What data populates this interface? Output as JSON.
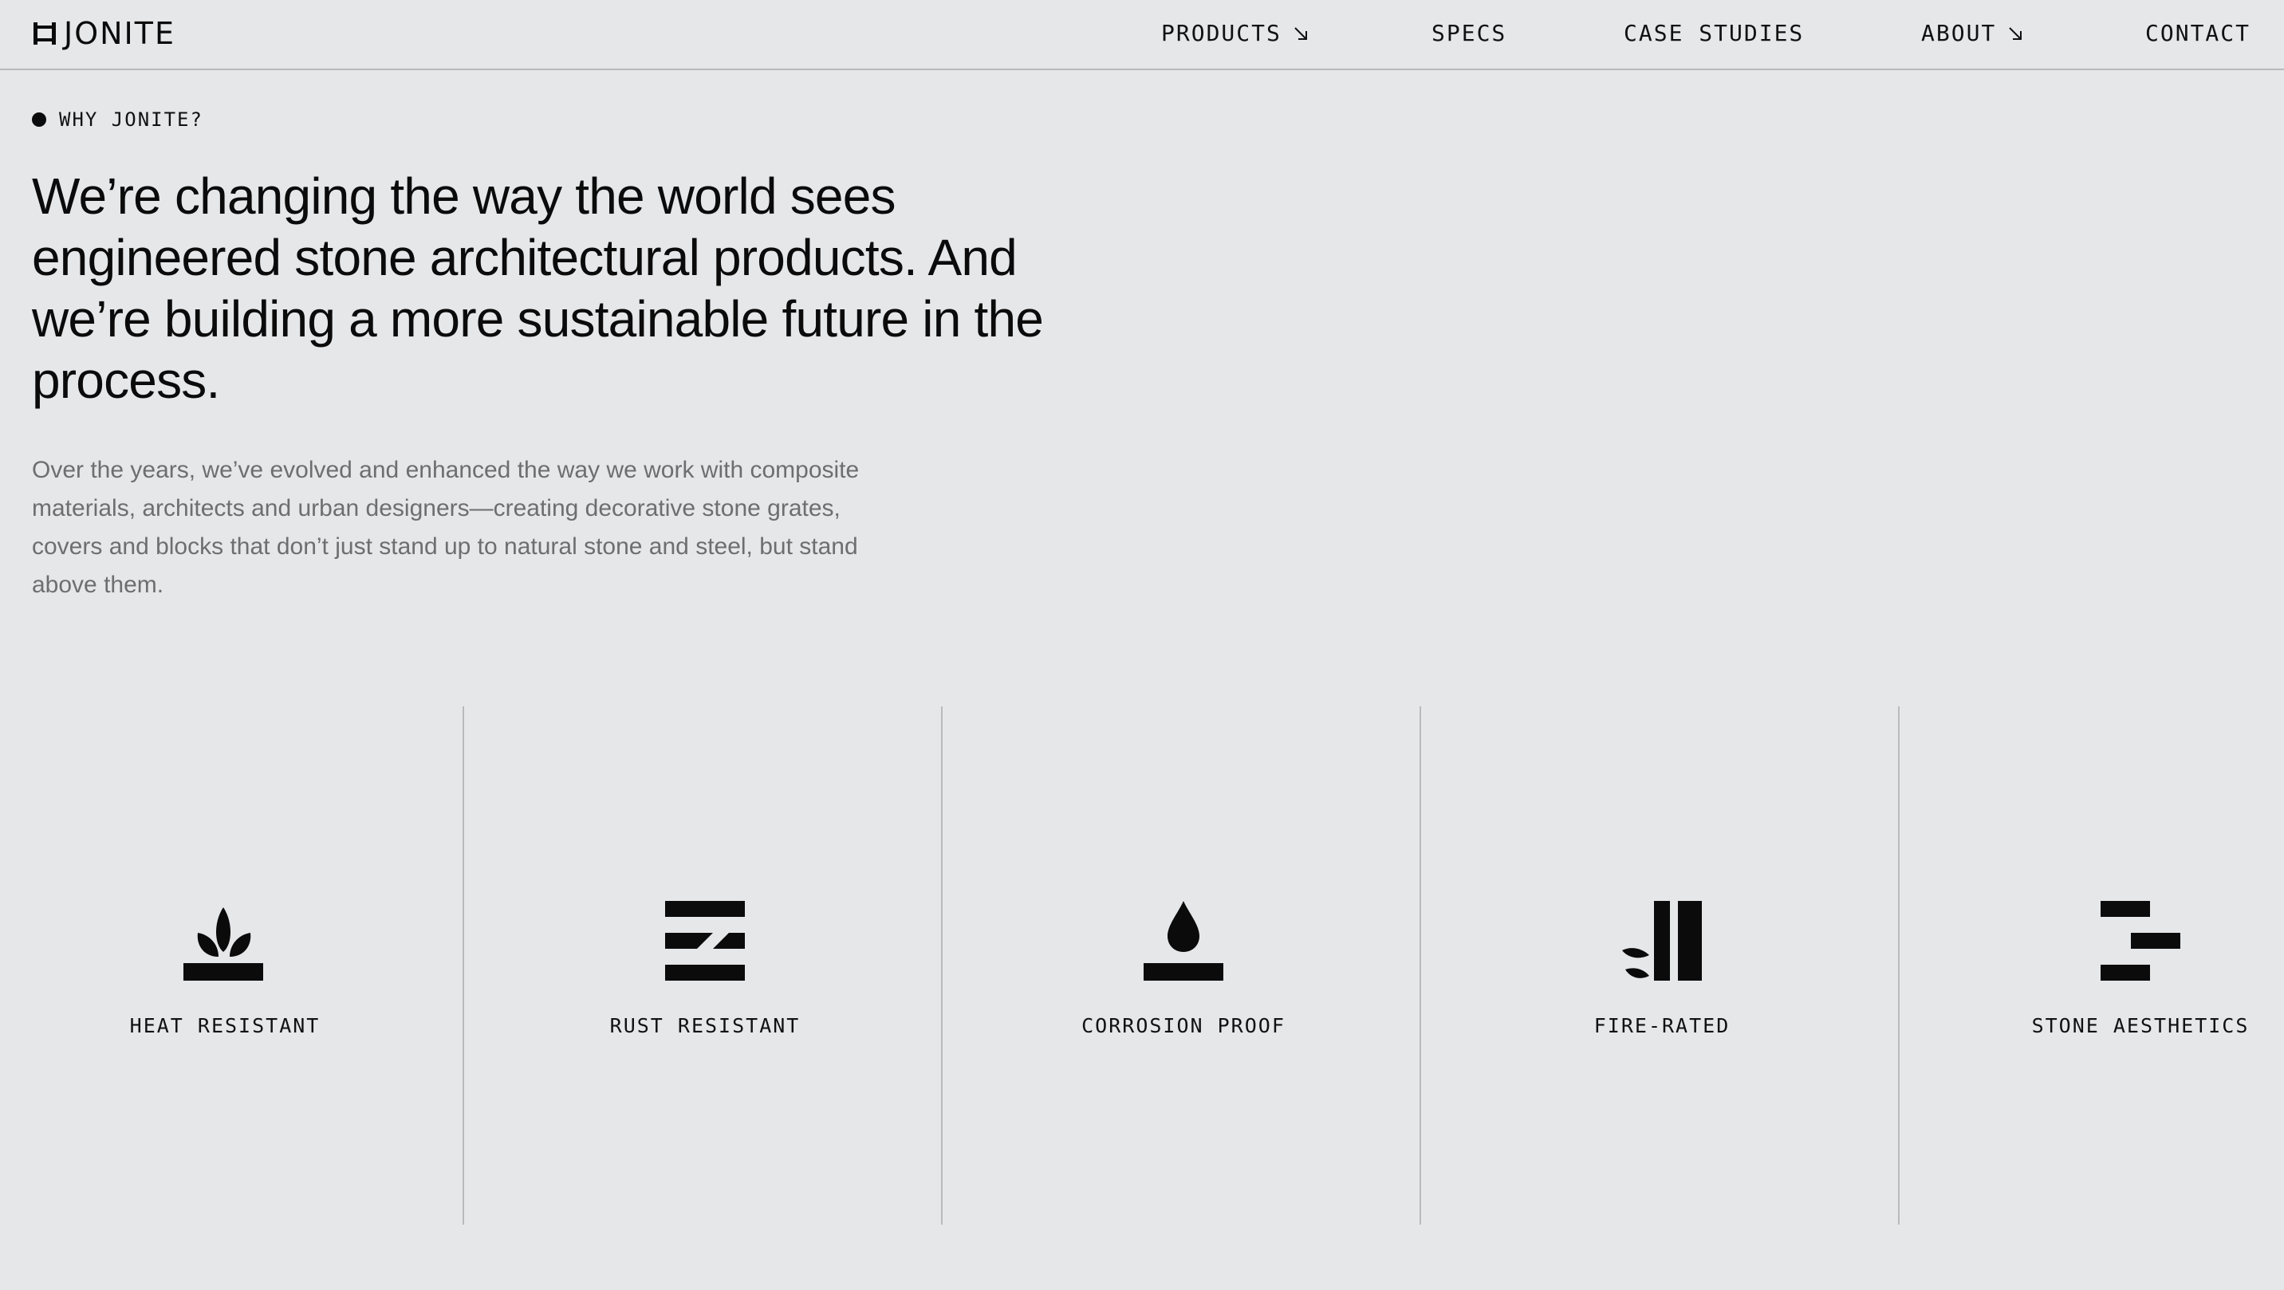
{
  "brand": {
    "name": "JONITE"
  },
  "nav": {
    "products": "PRODUCTS",
    "specs": "SPECS",
    "case_studies": "CASE STUDIES",
    "about": "ABOUT",
    "contact": "CONTACT"
  },
  "intro": {
    "eyebrow": "WHY JONITE?",
    "headline": "We’re changing the way the world sees engineered stone architectural products. And we’re building a more sustainable future in the process.",
    "body": "Over the years, we’ve evolved and enhanced the way we work with composite materials, architects and urban designers—creating decorative stone grates, covers and blocks that don’t just stand up to natural stone and steel, but stand above them."
  },
  "features": [
    {
      "icon": "heat-resistant-icon",
      "label": "HEAT RESISTANT"
    },
    {
      "icon": "rust-resistant-icon",
      "label": "RUST RESISTANT"
    },
    {
      "icon": "corrosion-proof-icon",
      "label": "CORROSION PROOF"
    },
    {
      "icon": "fire-rated-icon",
      "label": "FIRE-RATED"
    },
    {
      "icon": "stone-aesthetics-icon",
      "label": "STONE AESTHETICS"
    }
  ],
  "colors": {
    "background": "#e6e7e9",
    "text": "#0b0b0b",
    "muted_text": "#6d6e70",
    "divider": "#b9babc"
  }
}
